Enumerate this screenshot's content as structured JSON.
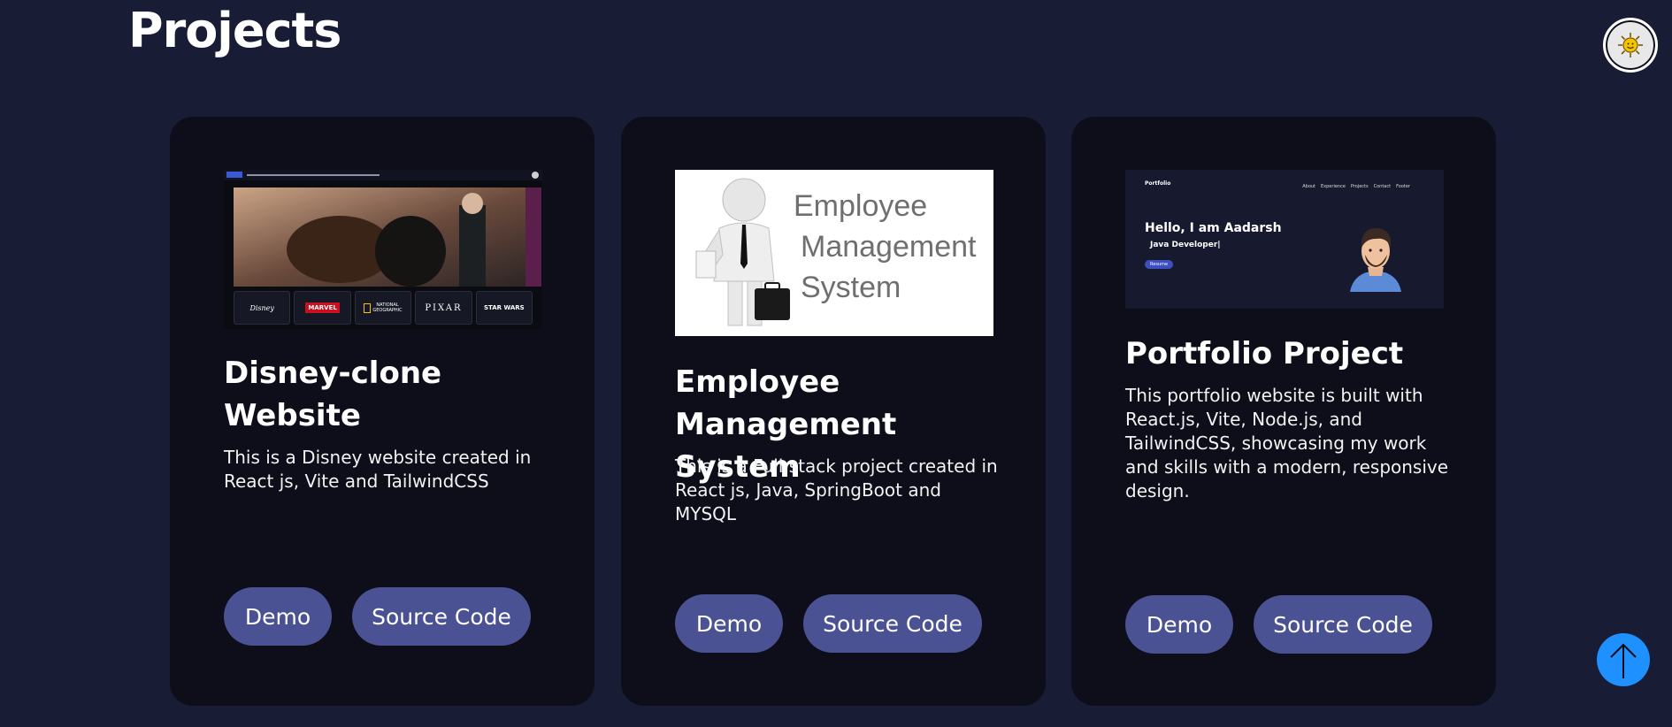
{
  "page": {
    "title": "Projects"
  },
  "theme_toggle": {
    "icon": "sun-icon"
  },
  "projects": [
    {
      "title": "Disney-clone Website",
      "description": "This is a Disney website created in React js, Vite and TailwindCSS",
      "demo_label": "Demo",
      "source_label": "Source Code",
      "thumbnail": {
        "brands": [
          "Disney",
          "MARVEL",
          "NATIONAL GEOGRAPHIC",
          "PIXAR",
          "STAR WARS"
        ]
      }
    },
    {
      "title": "Employee Management System",
      "description": "This is a Full stack project created in React js, Java, SpringBoot and MYSQL",
      "demo_label": "Demo",
      "source_label": "Source Code",
      "thumbnail": {
        "line1": "Employee",
        "line2": "Management",
        "line3": "System"
      }
    },
    {
      "title": "Portfolio Project",
      "description": "This portfolio website is built with React.js, Vite, Node.js, and TailwindCSS, showcasing my work and skills with a modern, responsive design.",
      "demo_label": "Demo",
      "source_label": "Source Code",
      "thumbnail": {
        "logo": "Portfolio",
        "nav": [
          "About",
          "Experience",
          "Projects",
          "Contact",
          "Footer"
        ],
        "greeting": "Hello, I am Aadarsh",
        "role": "Java Developer|",
        "resume": "Resume"
      }
    }
  ],
  "scroll_top": {
    "icon": "arrow-up-icon"
  },
  "colors": {
    "background": "#181c34",
    "card": "#0d0e1a",
    "button": "#4a5293",
    "scroll_button": "#1e90ff"
  }
}
